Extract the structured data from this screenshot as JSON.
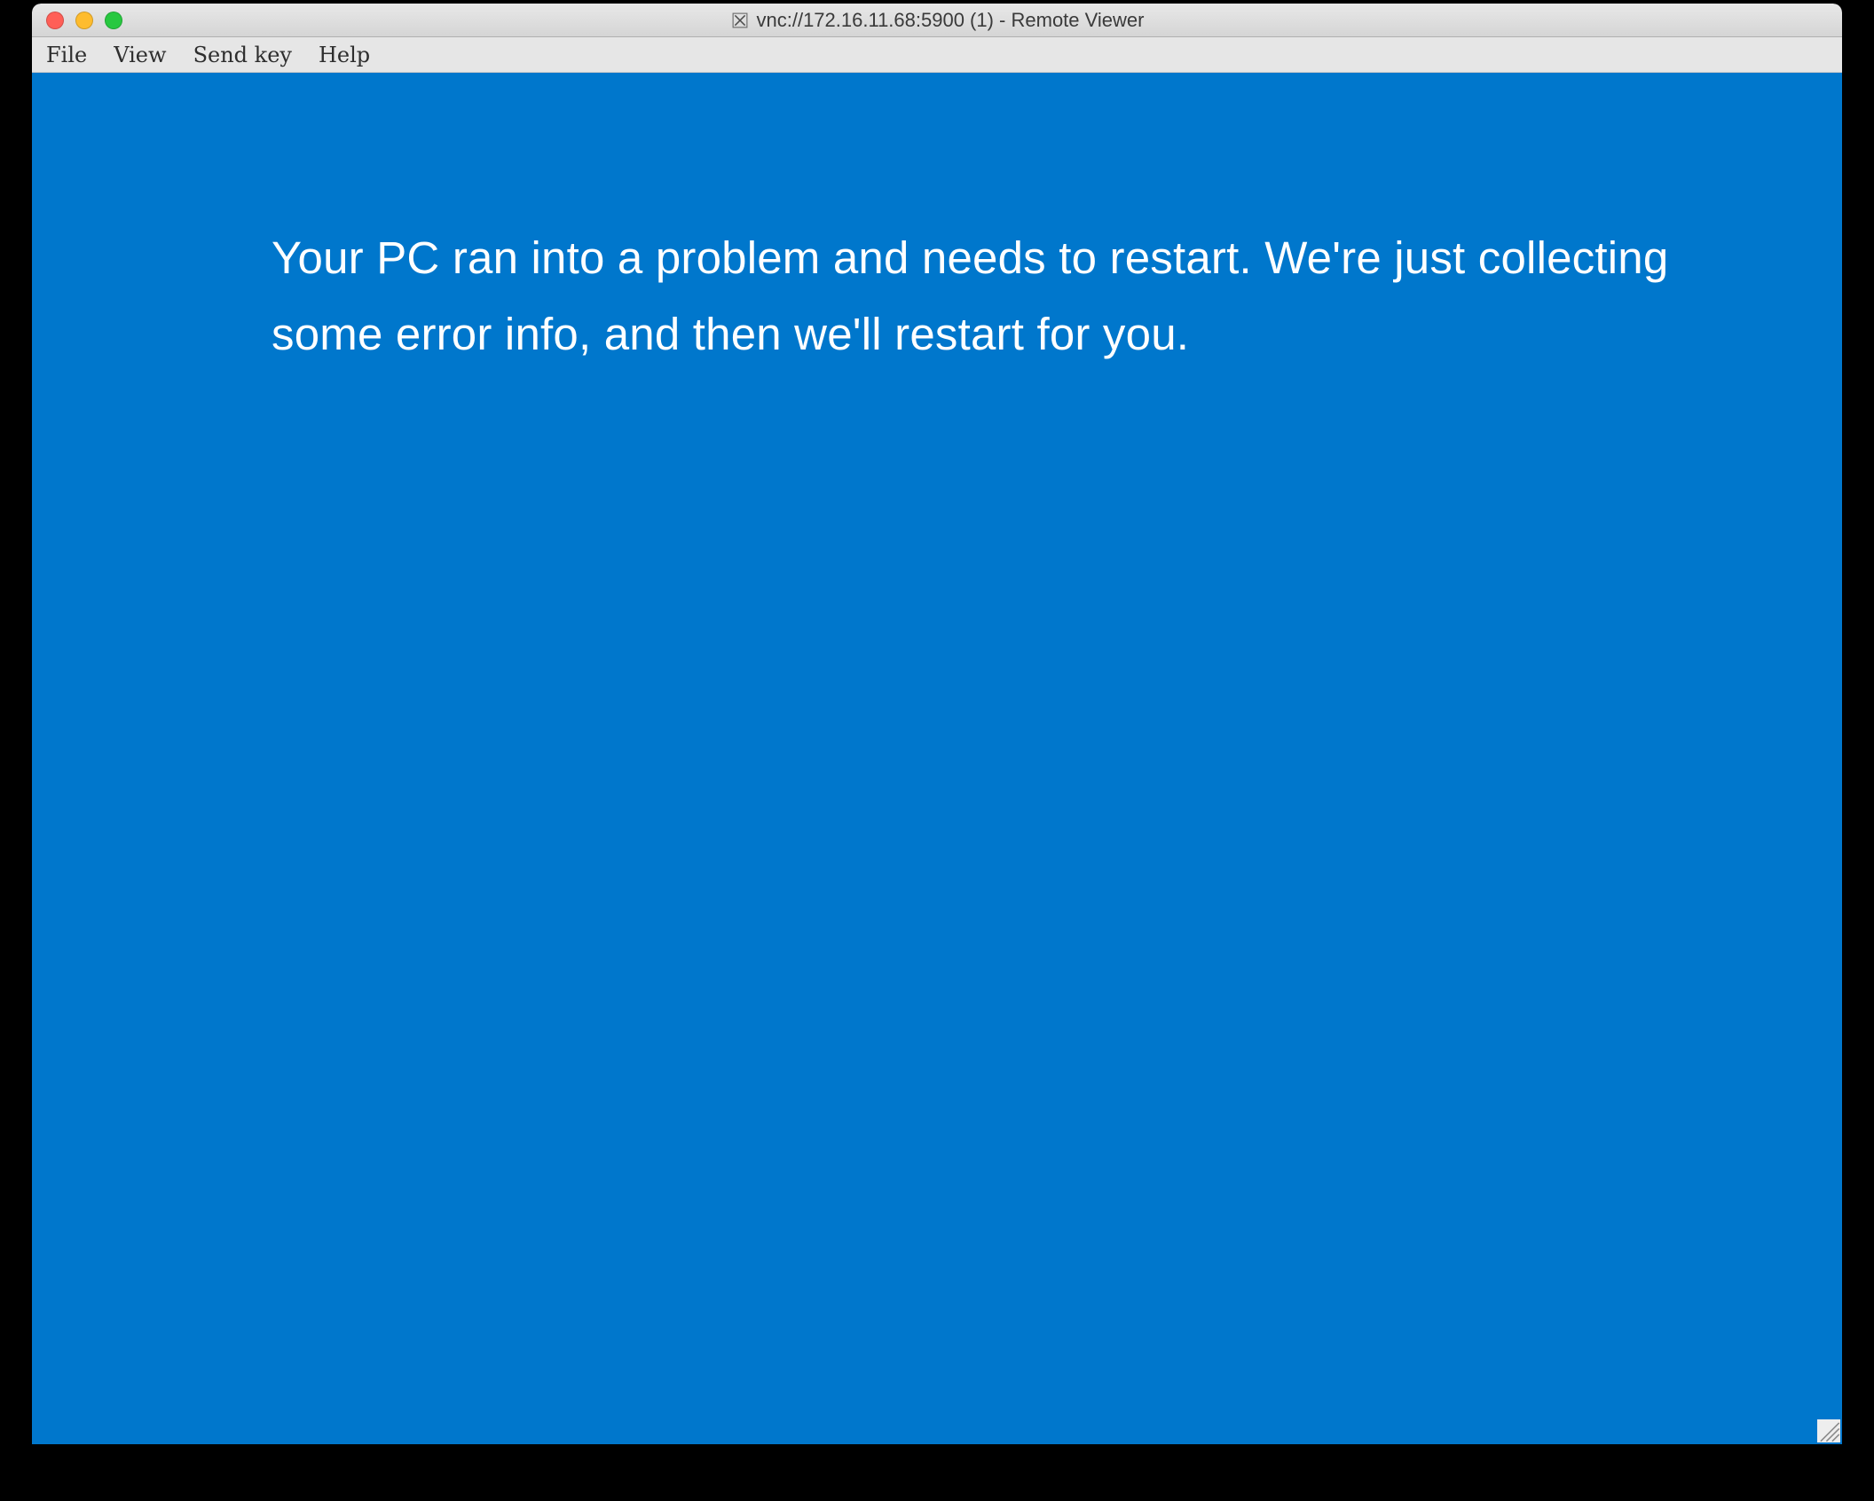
{
  "window": {
    "title": "vnc://172.16.11.68:5900 (1) - Remote Viewer",
    "icon_name": "x11-icon"
  },
  "menu": {
    "items": [
      "File",
      "View",
      "Send key",
      "Help"
    ]
  },
  "screen": {
    "error_message": "Your PC ran into a problem and needs to restart. We're just collecting some error info, and then we'll restart for you.",
    "bg_color": "#0077cc"
  }
}
